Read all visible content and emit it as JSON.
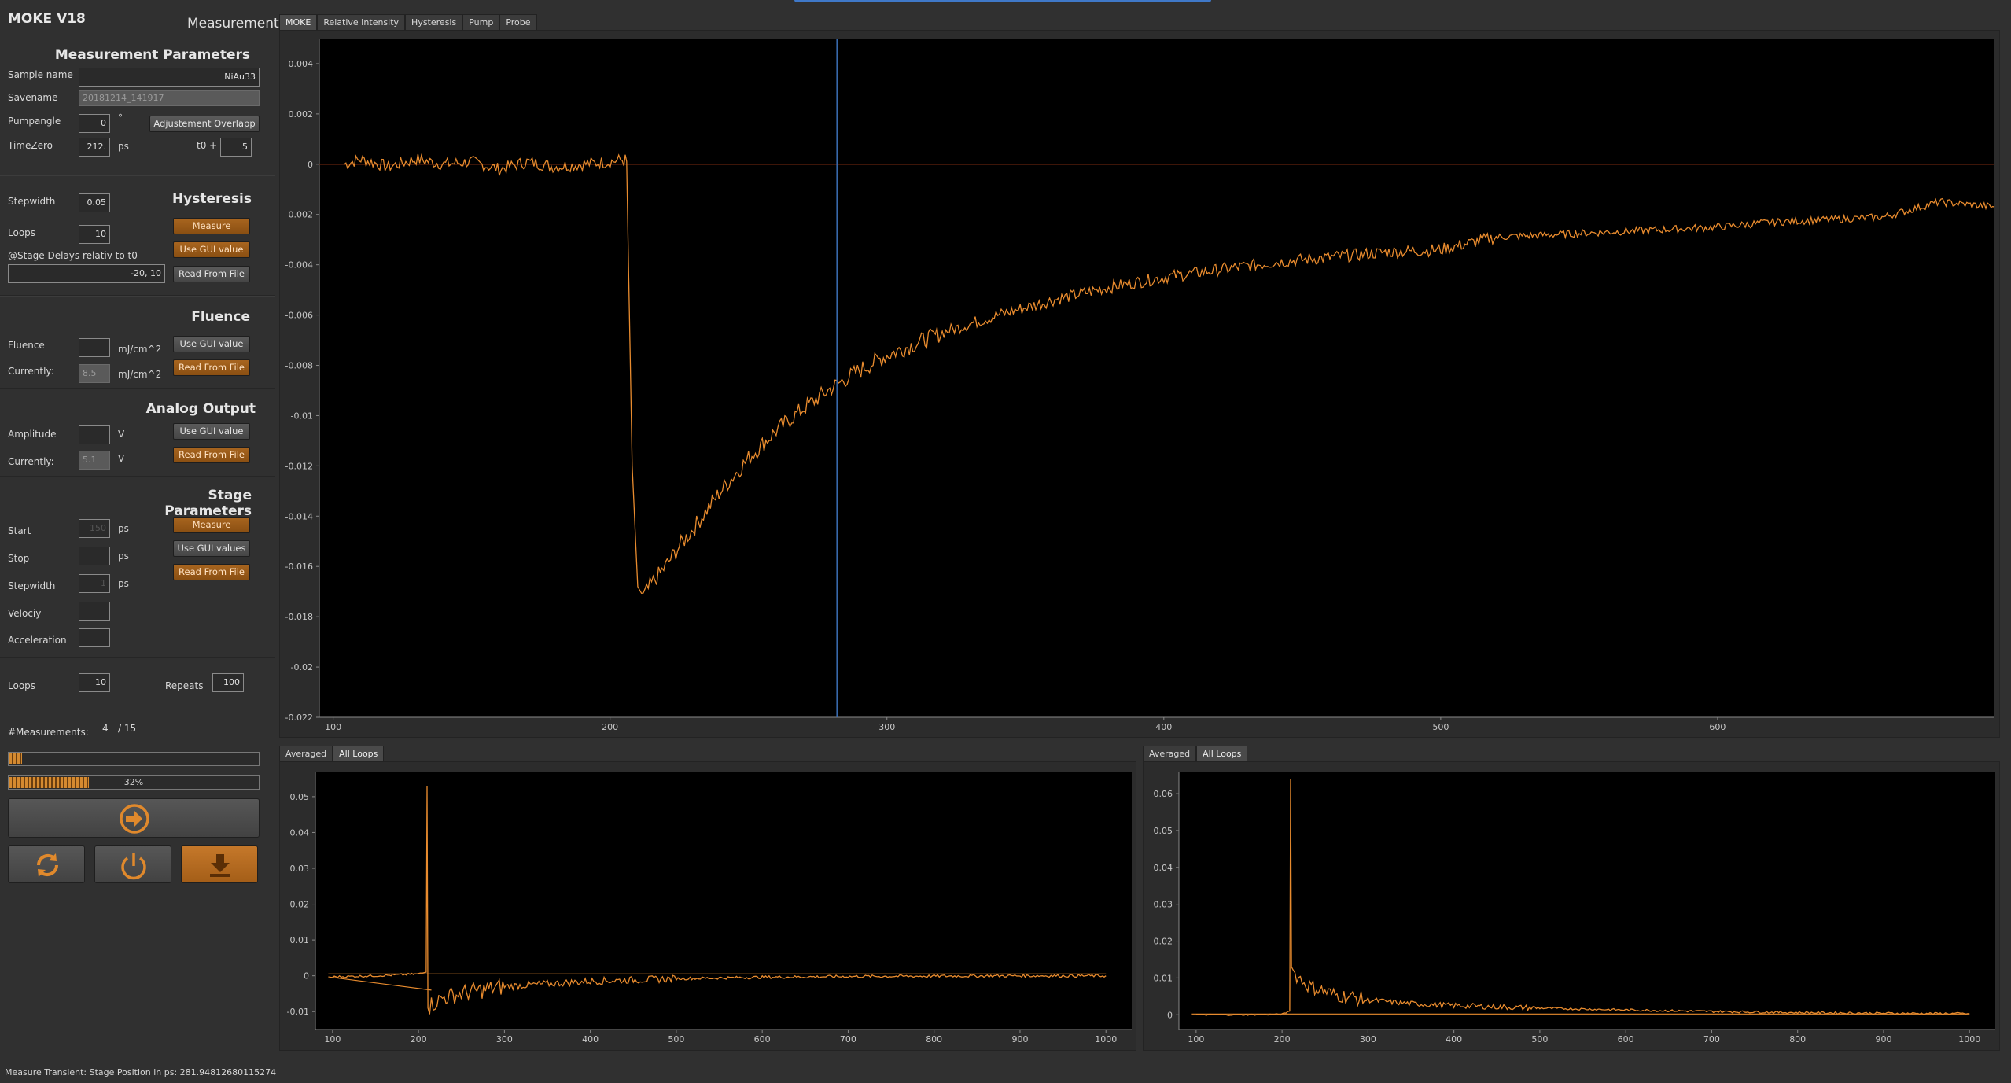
{
  "app": {
    "title": "MOKE V18",
    "mode_label": "Measurement"
  },
  "measurement_parameters": {
    "title": "Measurement Parameters",
    "sample_name_label": "Sample name",
    "sample_name_value": "NiAu33",
    "savename_label": "Savename",
    "savename_value": "20181214_141917",
    "pumpangle_label": "Pumpangle",
    "pumpangle_value": "0",
    "pumpangle_unit": "°",
    "adjust_overlap_button": "Adjustement Overlapp",
    "timezero_label": "TimeZero",
    "timezero_value": "212.",
    "timezero_unit": "ps",
    "t0_plus_label": "t0 +",
    "t0_plus_value": "5"
  },
  "hysteresis": {
    "title": "Hysteresis",
    "stepwidth_label": "Stepwidth",
    "stepwidth_value": "0.05",
    "loops_label": "Loops",
    "loops_value": "10",
    "measure_button": "Measure",
    "use_gui_button": "Use GUI value",
    "read_file_button": "Read From File",
    "stage_delays_label": "@Stage Delays relativ to t0",
    "stage_delays_value": "-20, 10"
  },
  "fluence": {
    "title": "Fluence",
    "fluence_label": "Fluence",
    "fluence_value": "",
    "unit": "mJ/cm^2",
    "currently_label": "Currently:",
    "currently_value": "8.5",
    "use_gui_button": "Use GUI value",
    "read_file_button": "Read From File"
  },
  "analog_output": {
    "title": "Analog Output",
    "amplitude_label": "Amplitude",
    "amplitude_value": "",
    "unit": "V",
    "currently_label": "Currently:",
    "currently_value": "5.1",
    "use_gui_button": "Use GUI value",
    "read_file_button": "Read From File"
  },
  "stage_parameters": {
    "title": "Stage Parameters",
    "start_label": "Start",
    "start_value": "150",
    "stop_label": "Stop",
    "stop_value": "",
    "stepwidth_label": "Stepwidth",
    "stepwidth_value": "1",
    "velocity_label": "Velociy",
    "acceleration_label": "Acceleration",
    "unit": "ps",
    "measure_button": "Measure",
    "use_gui_button": "Use GUI values",
    "read_file_button": "Read From File"
  },
  "loops": {
    "loops_label": "Loops",
    "loops_value": "10",
    "repeats_label": "Repeats",
    "repeats_value": "100"
  },
  "measurements": {
    "label": "#Measurements:",
    "current": "4",
    "total": "/ 15"
  },
  "progress": {
    "loop_fraction": 0.05,
    "total_fraction": 0.32,
    "total_text": "32%"
  },
  "buttons": {
    "start_icon": "arrow-right-circle-icon",
    "refresh_icon": "refresh-icon",
    "power_icon": "power-icon",
    "download_icon": "download-icon"
  },
  "tabs": {
    "items": [
      "MOKE",
      "Relative Intensity",
      "Hysteresis",
      "Pump",
      "Probe"
    ],
    "active": "MOKE"
  },
  "subtabs": {
    "items": [
      "Averaged",
      "All Loops"
    ]
  },
  "status": "Measure Transient: Stage Position in ps: 281.94812680115274",
  "colors": {
    "curve": "#e88b2e",
    "background": "#303030",
    "plot_bg": "#000000",
    "cursor": "#3b6fb5",
    "zero_line": "#7a2a10"
  },
  "chart_data": [
    {
      "type": "line",
      "name": "main-moke-transient",
      "xlim": [
        95,
        700
      ],
      "ylim": [
        -0.022,
        0.005
      ],
      "x_ticks": [
        100,
        200,
        300,
        400,
        500,
        600
      ],
      "y_ticks": [
        0.004,
        0.002,
        0,
        -0.002,
        -0.004,
        -0.006,
        -0.008,
        -0.01,
        -0.012,
        -0.014,
        -0.016,
        -0.018,
        -0.02,
        -0.022
      ],
      "cursor_x": 281.95,
      "zero_line": 0,
      "series": [
        {
          "x": [
            104,
            110,
            120,
            130,
            140,
            150,
            160,
            170,
            180,
            190,
            200,
            205,
            206,
            208,
            210,
            212,
            215,
            220,
            225,
            230,
            240,
            250,
            260,
            270,
            280,
            290,
            300,
            320,
            340,
            360,
            380,
            400,
            420,
            440,
            460,
            480,
            500,
            520,
            540,
            560,
            580,
            600,
            620,
            640,
            660,
            680,
            700
          ],
          "y": [
            0.0,
            0.0002,
            -0.0001,
            0.0002,
            0.0,
            0.0001,
            -0.0002,
            0.0001,
            -0.0001,
            0.0,
            0.0001,
            0.0002,
            0.0,
            -0.012,
            -0.0168,
            -0.0172,
            -0.0167,
            -0.016,
            -0.0152,
            -0.0145,
            -0.013,
            -0.0117,
            -0.0106,
            -0.0097,
            -0.0089,
            -0.0082,
            -0.0076,
            -0.0067,
            -0.006,
            -0.0054,
            -0.0049,
            -0.0045,
            -0.0042,
            -0.0039,
            -0.0037,
            -0.0035,
            -0.0034,
            -0.0029,
            -0.0028,
            -0.0027,
            -0.0026,
            -0.0025,
            -0.0023,
            -0.0022,
            -0.0021,
            -0.0015,
            -0.0017
          ]
        }
      ]
    },
    {
      "type": "line",
      "name": "bottom-left-all-loops",
      "xlim": [
        80,
        1030
      ],
      "ylim": [
        -0.015,
        0.057
      ],
      "x_ticks": [
        100,
        200,
        300,
        400,
        500,
        600,
        700,
        800,
        900,
        1000
      ],
      "y_ticks": [
        0.05,
        0.04,
        0.03,
        0.02,
        0.01,
        0,
        -0.01
      ],
      "series": [
        {
          "x": [
            100,
            150,
            200,
            209,
            210,
            211,
            215,
            230,
            260,
            300,
            400,
            500,
            600,
            700,
            800,
            900,
            1000
          ],
          "y": [
            -0.0003,
            0.0,
            0.0005,
            0.001,
            0.053,
            -0.009,
            -0.008,
            -0.006,
            -0.0045,
            -0.003,
            -0.0015,
            -0.0008,
            -0.0004,
            -0.0002,
            -0.0001,
            0.0,
            0.0
          ]
        }
      ]
    },
    {
      "type": "line",
      "name": "bottom-right-all-loops",
      "xlim": [
        80,
        1030
      ],
      "ylim": [
        -0.004,
        0.066
      ],
      "x_ticks": [
        100,
        200,
        300,
        400,
        500,
        600,
        700,
        800,
        900,
        1000
      ],
      "y_ticks": [
        0.06,
        0.05,
        0.04,
        0.03,
        0.02,
        0.01,
        0
      ],
      "series": [
        {
          "x": [
            100,
            150,
            200,
            209,
            210,
            211,
            215,
            230,
            260,
            300,
            350,
            400,
            500,
            600,
            700,
            800,
            900,
            1000
          ],
          "y": [
            0.0,
            0.0,
            0.0001,
            0.001,
            0.064,
            0.013,
            0.011,
            0.008,
            0.0055,
            0.004,
            0.003,
            0.0025,
            0.0018,
            0.0013,
            0.0009,
            0.0006,
            0.0004,
            0.0003
          ]
        }
      ]
    }
  ]
}
